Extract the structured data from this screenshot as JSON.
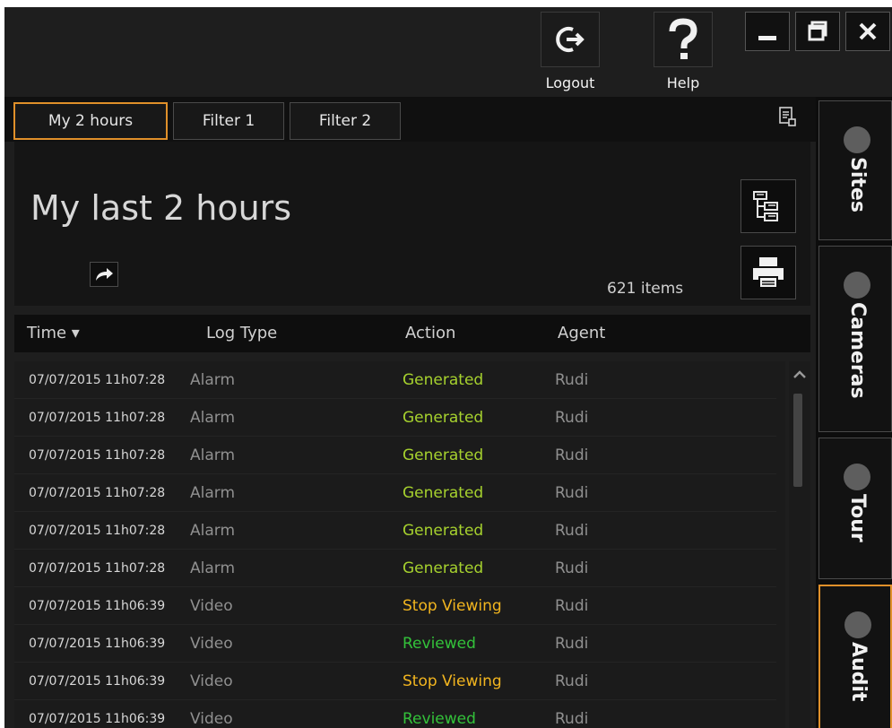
{
  "topbar": {
    "logout_label": "Logout",
    "help_label": "Help",
    "icons": [
      "logout-icon",
      "help-icon",
      "minimize-icon",
      "restore-icon",
      "close-icon"
    ]
  },
  "tabs": [
    {
      "label": "My 2 hours",
      "active": true
    },
    {
      "label": "Filter 1",
      "active": false
    },
    {
      "label": "Filter 2",
      "active": false
    }
  ],
  "header": {
    "title": "My last 2 hours",
    "count": "621 items"
  },
  "table": {
    "columns": [
      "Time ▾",
      "Log Type",
      "Action",
      "Agent"
    ],
    "rows": [
      {
        "time": "07/07/2015 11h07:28",
        "type": "Alarm",
        "action": "Generated",
        "agent": "Rudi"
      },
      {
        "time": "07/07/2015 11h07:28",
        "type": "Alarm",
        "action": "Generated",
        "agent": "Rudi"
      },
      {
        "time": "07/07/2015 11h07:28",
        "type": "Alarm",
        "action": "Generated",
        "agent": "Rudi"
      },
      {
        "time": "07/07/2015 11h07:28",
        "type": "Alarm",
        "action": "Generated",
        "agent": "Rudi"
      },
      {
        "time": "07/07/2015 11h07:28",
        "type": "Alarm",
        "action": "Generated",
        "agent": "Rudi"
      },
      {
        "time": "07/07/2015 11h07:28",
        "type": "Alarm",
        "action": "Generated",
        "agent": "Rudi"
      },
      {
        "time": "07/07/2015 11h06:39",
        "type": "Video",
        "action": "Stop Viewing",
        "agent": "Rudi"
      },
      {
        "time": "07/07/2015 11h06:39",
        "type": "Video",
        "action": "Reviewed",
        "agent": "Rudi"
      },
      {
        "time": "07/07/2015 11h06:39",
        "type": "Video",
        "action": "Stop Viewing",
        "agent": "Rudi"
      },
      {
        "time": "07/07/2015 11h06:39",
        "type": "Video",
        "action": "Reviewed",
        "agent": "Rudi"
      }
    ]
  },
  "sidetabs": [
    {
      "label": "Sites",
      "active": false
    },
    {
      "label": "Cameras",
      "active": false
    },
    {
      "label": "Tour",
      "active": false
    },
    {
      "label": "Audit",
      "active": true
    }
  ],
  "colors": {
    "accent": "#e0902a",
    "generated": "#a6d12e",
    "stop_viewing": "#f2b51f",
    "reviewed": "#33c23a"
  }
}
